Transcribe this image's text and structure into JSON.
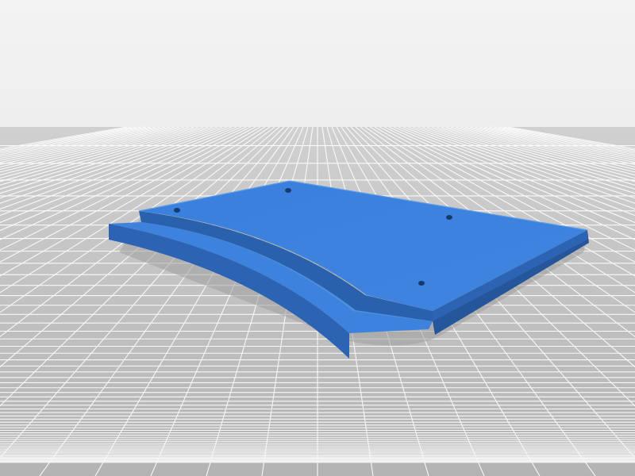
{
  "scene": {
    "object": "curved-track-plate",
    "colors": {
      "sky_top": "#f3f3f3",
      "sky_bottom": "#e0e0e0",
      "floor_near": "#b3b3b3",
      "floor_far": "#d0d0d0",
      "grid_line": "#ffffff",
      "plate_top": "#3d83de",
      "plate_side": "#2c64b3",
      "plate_side_dark": "#25559a",
      "channel_floor": "#4a8fe2",
      "shadow": "#9a9a9a",
      "hole": "#143a6e"
    },
    "mounting_holes": 4
  }
}
